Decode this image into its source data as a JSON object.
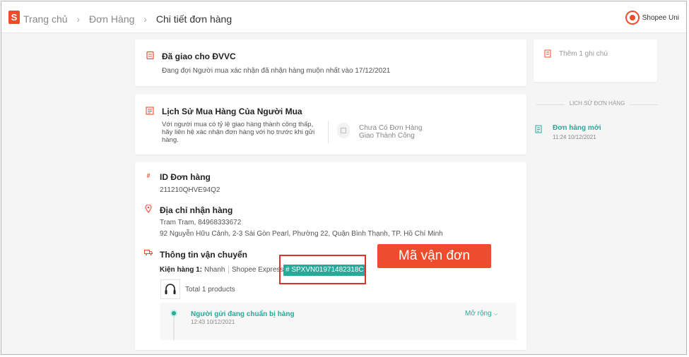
{
  "header": {
    "breadcrumb": [
      "Trang chủ",
      "Đơn Hàng",
      "Chi tiết đơn hàng"
    ],
    "brand": "Shopee Uni",
    "logo_letter": "S"
  },
  "status_card": {
    "title": "Đã giao cho ĐVVC",
    "desc": "Đang đợi Người mua xác nhận đã nhận hàng muộn nhất vào 17/12/2021"
  },
  "buyer_history": {
    "title": "Lịch Sử Mua Hàng Của Người Mua",
    "desc_lines": [
      "Với người mua có tỷ lệ giao hàng thành công thấp,",
      "hãy liên hệ xác nhận đơn hàng với họ trước khi gửi",
      "hàng."
    ],
    "stat_lines": [
      "Chưa Có Đơn Hàng",
      "Giao Thành Công"
    ]
  },
  "order": {
    "id_label": "ID Đơn hàng",
    "id_value": "211210QHVE94Q2",
    "address_label": "Địa chỉ nhận hàng",
    "address_name": "Tram Tram, 84968333672",
    "address_detail": "92 Nguyễn Hữu Cảnh, 2-3 Sài Gòn Pearl, Phường 22, Quận Bình Thạnh, TP. Hồ Chí Minh",
    "shipping_label": "Thông tin vận chuyển",
    "package_label": "Kiện hàng 1:",
    "package_speed": "Nhanh",
    "carrier": "Shopee Express",
    "tracking_code": "# SPXVN01971482318C",
    "products_text": "Total 1 products",
    "timeline": {
      "status": "Người gửi đang chuẩn bị hàng",
      "time": "12:43 10/12/2021",
      "expand_label": "Mở rộng"
    }
  },
  "annotation": {
    "callout_text": "Mã vận đơn"
  },
  "sidebar": {
    "add_note": "Thêm 1 ghi chú",
    "history_title": "LỊCH SỬ ĐƠN HÀNG",
    "history_items": [
      {
        "title": "Đơn hàng mới",
        "time": "11:24 10/12/2021"
      }
    ]
  },
  "colors": {
    "accent": "#ee4d2d",
    "teal": "#26aa99",
    "highlight_border": "#e0322b"
  },
  "icons": [
    "shopee-logo-icon",
    "chevron-right-icon",
    "shopee-uni-icon",
    "clipboard-icon",
    "history-list-icon",
    "order-id-icon",
    "location-pin-icon",
    "truck-icon",
    "note-icon",
    "order-doc-icon",
    "chevron-down-icon",
    "headphones-icon",
    "box-icon"
  ]
}
